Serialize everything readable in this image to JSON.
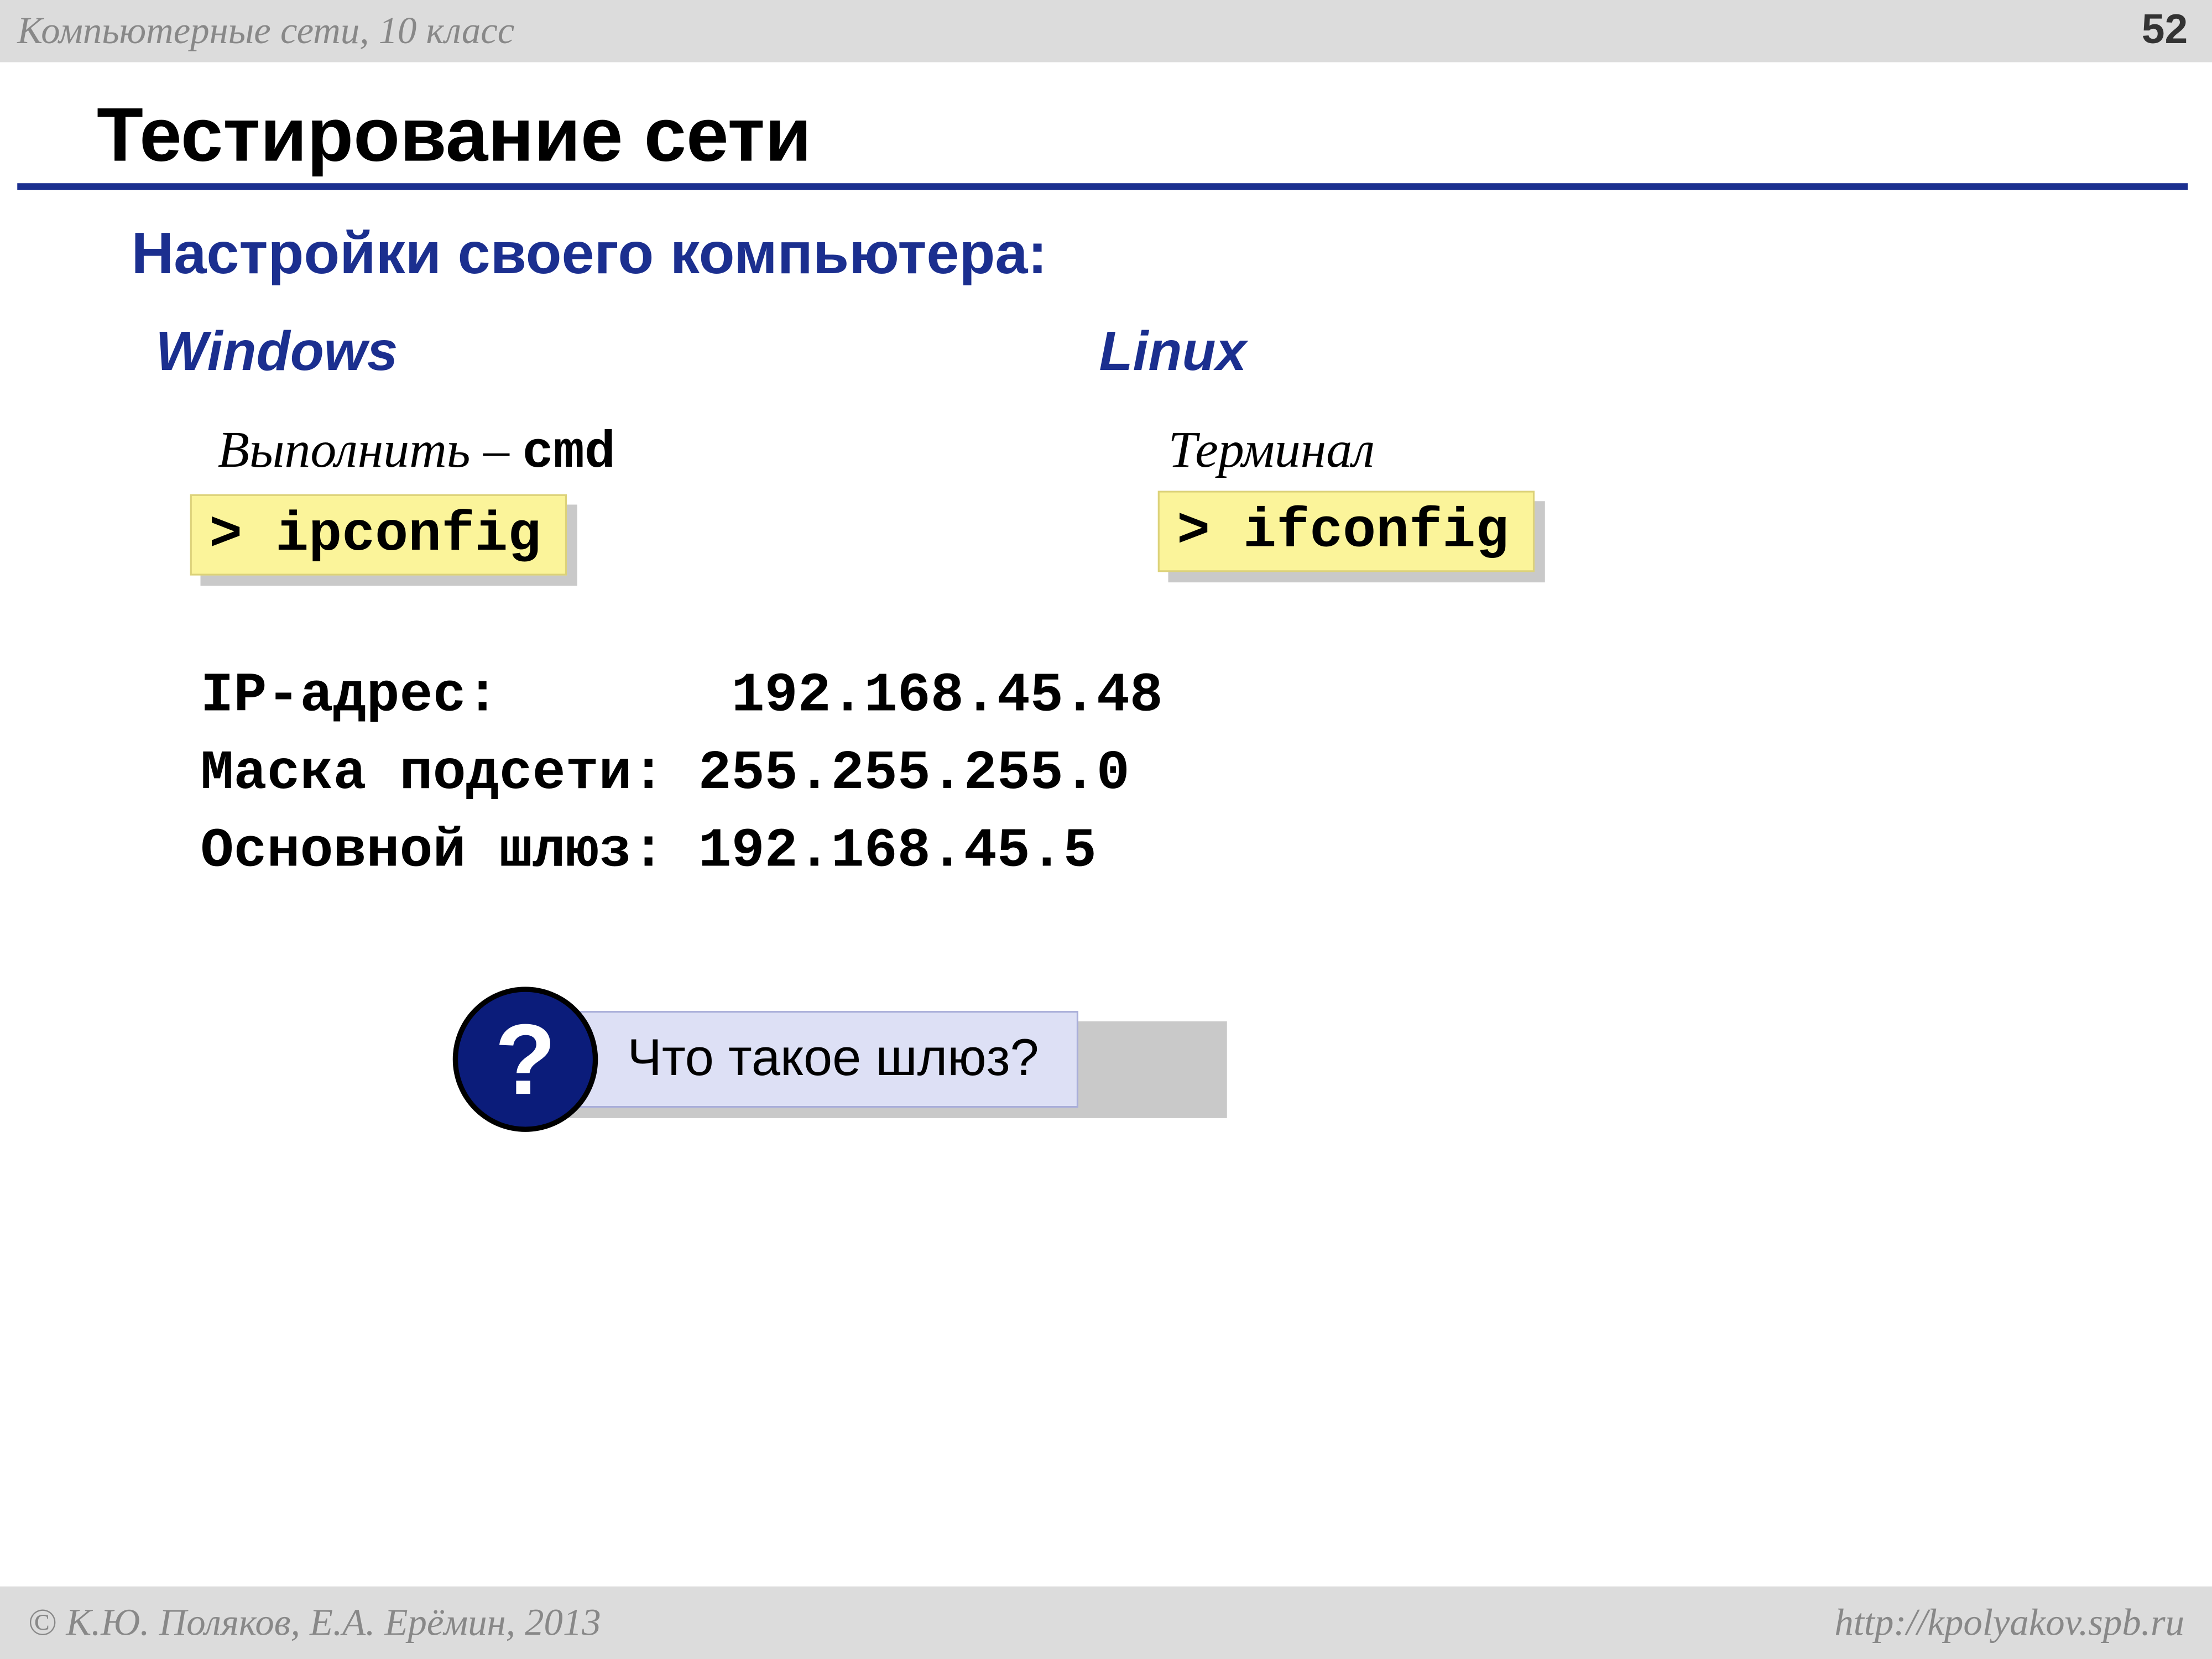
{
  "header": {
    "course": "Компьютерные сети, 10 класс",
    "page": "52"
  },
  "title": "Тестирование сети",
  "subtitle": "Настройки своего компьютера:",
  "windows": {
    "label": "Windows",
    "run_label": "Выполнить",
    "run_sep": " – ",
    "run_cmd": "cmd",
    "command": "> ipconfig"
  },
  "linux": {
    "label": "Linux",
    "run_label": "Терминал",
    "command": "> ifconfig"
  },
  "netinfo": {
    "ip_label": "IP-адрес:",
    "ip_value": "192.168.45.48",
    "mask_label": "Маска подсети:",
    "mask_value": "255.255.255.0",
    "gw_label": "Основной шлюз:",
    "gw_value": "192.168.45.5"
  },
  "question": {
    "mark": "?",
    "text": "Что такое шлюз?"
  },
  "footer": {
    "left": "© К.Ю. Поляков, Е.А. Ерёмин, 2013",
    "right": "http://kpolyakov.spb.ru"
  }
}
